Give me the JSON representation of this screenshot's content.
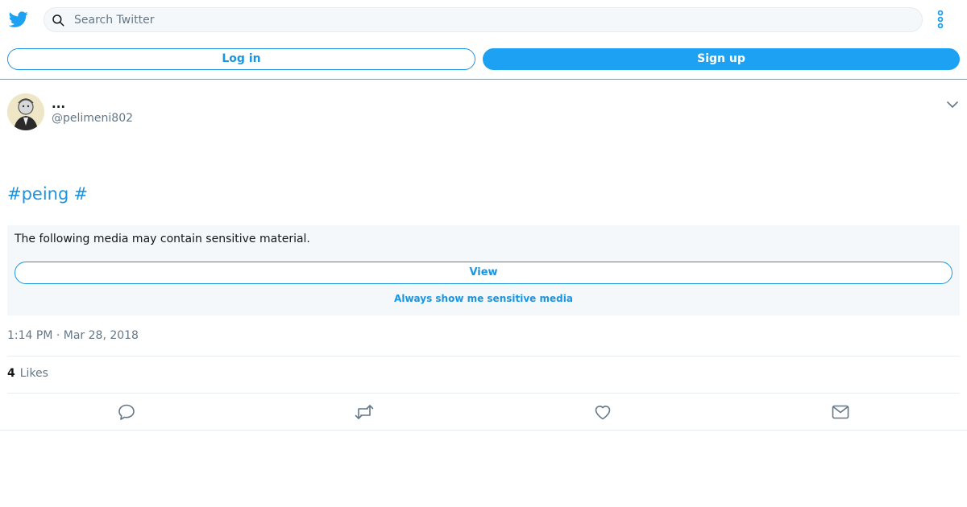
{
  "header": {
    "logo_icon": "twitter-bird-icon",
    "search_placeholder": "Search Twitter",
    "more_icon": "more-vertical-icon"
  },
  "auth": {
    "login_label": "Log in",
    "signup_label": "Sign up"
  },
  "tweet": {
    "display_name": "...",
    "handle": "@pelimeni802",
    "hashtags": [
      "#peing",
      "#"
    ],
    "sensitive": {
      "message": "The following media may contain sensitive material.",
      "view_label": "View",
      "always_show_label": "Always show me sensitive media"
    },
    "timestamp": "1:14 PM · Mar 28, 2018",
    "likes_count": "4",
    "likes_label": "Likes"
  },
  "actions": [
    "reply-icon",
    "retweet-icon",
    "like-icon",
    "direct-message-icon"
  ],
  "colors": {
    "brand_blue": "#1da1f2",
    "link_blue": "#1b95e0",
    "muted_gray": "#657786",
    "panel_bg": "#f5f8fa"
  }
}
